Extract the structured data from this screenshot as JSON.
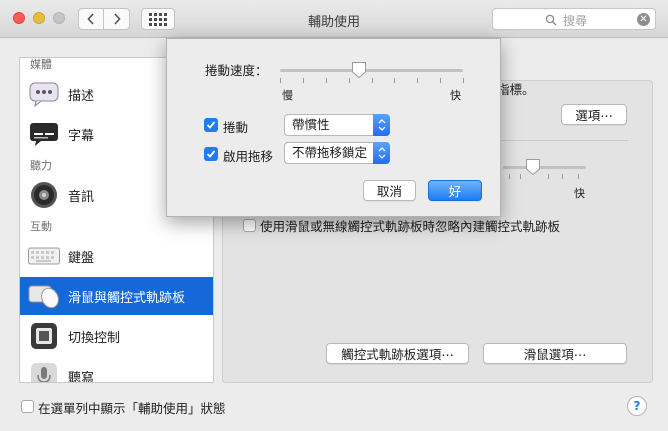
{
  "window": {
    "title": "輔助使用",
    "search_placeholder": "搜尋",
    "search_clear": "✕"
  },
  "sidebar": {
    "sections": [
      "媒體",
      "聽力",
      "互動"
    ],
    "items": [
      {
        "label": "描述",
        "icon": "speech-bubble-icon"
      },
      {
        "label": "字幕",
        "icon": "captions-icon"
      },
      {
        "label": "音訊",
        "icon": "speaker-icon"
      },
      {
        "label": "鍵盤",
        "icon": "keyboard-icon"
      },
      {
        "label": "滑鼠與觸控式軌跡板",
        "icon": "mouse-trackpad-icon",
        "selected": true
      },
      {
        "label": "切換控制",
        "icon": "switch-control-icon"
      },
      {
        "label": "聽寫",
        "icon": "microphone-icon"
      }
    ]
  },
  "main": {
    "pointer_text_fragment": "指標。",
    "options_button": "選項⋯",
    "slow_label_fragment": "快",
    "ignore_trackpad_label": "使用滑鼠或無線觸控式軌跡板時忽略內建觸控式軌跡板",
    "trackpad_options_button": "觸控式軌跡板選項⋯",
    "mouse_options_button": "滑鼠選項⋯"
  },
  "footer": {
    "show_in_menubar_label": "在選單列中顯示「輔助使用」狀態",
    "help_label": "?"
  },
  "popup": {
    "scroll_speed_label": "捲動速度：",
    "scroll_speed_value": 0.43,
    "slow_label": "慢",
    "fast_label": "快",
    "scroll_checkbox_label": "捲動",
    "scroll_checked": true,
    "scroll_select_value": "帶慣性",
    "drag_checkbox_label": "啟用拖移",
    "drag_checked": true,
    "drag_select_value": "不帶拖移鎖定",
    "cancel_button": "取消",
    "ok_button": "好"
  },
  "colors": {
    "accent": "#1f7cf1",
    "selection": "#1468d8"
  }
}
